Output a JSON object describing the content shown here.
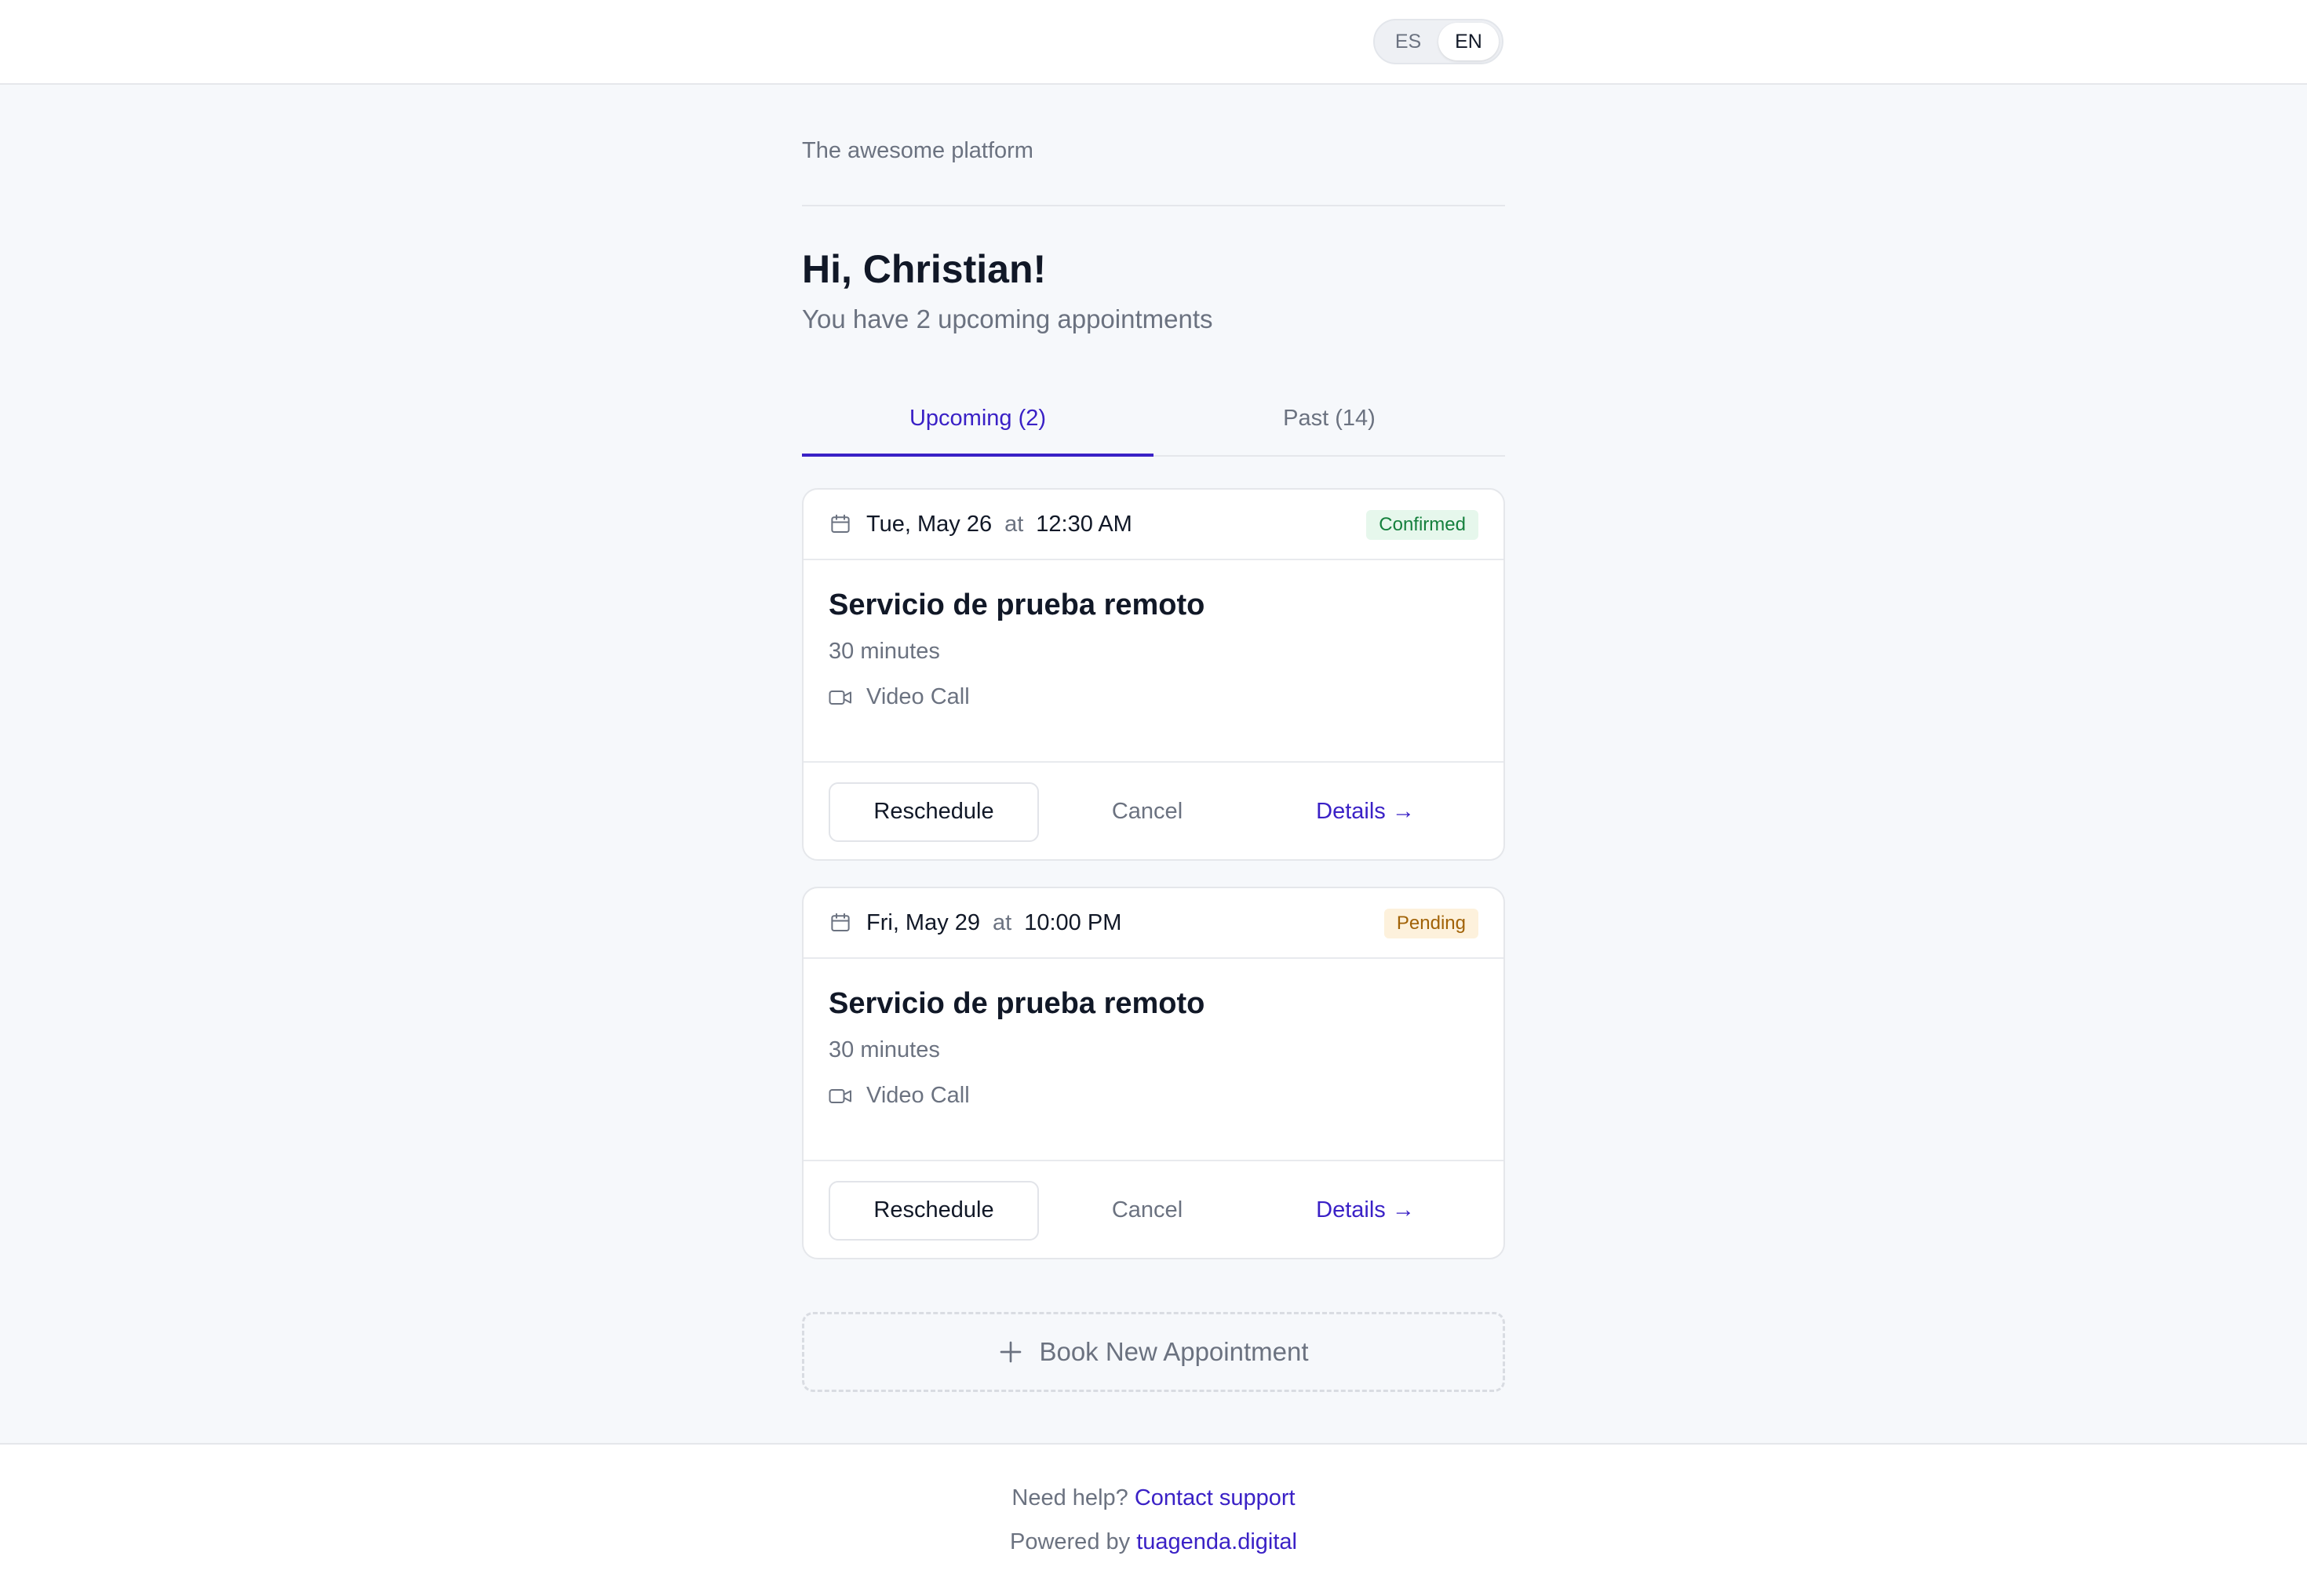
{
  "header": {
    "languages": [
      {
        "code": "ES",
        "active": false
      },
      {
        "code": "EN",
        "active": true
      }
    ]
  },
  "brand": "The awesome platform",
  "greeting": "Hi, Christian!",
  "subtitle": "You have 2 upcoming appointments",
  "tabs": [
    {
      "label": "Upcoming (2)",
      "active": true
    },
    {
      "label": "Past (14)",
      "active": false
    }
  ],
  "appointments": [
    {
      "date": "Tue, May 26",
      "at": "at",
      "time": "12:30 AM",
      "status": "Confirmed",
      "service": "Servicio de prueba remoto",
      "duration": "30 minutes",
      "location": "Video Call",
      "actions": {
        "reschedule": "Reschedule",
        "cancel": "Cancel",
        "details": "Details →"
      }
    },
    {
      "date": "Fri, May 29",
      "at": "at",
      "time": "10:00 PM",
      "status": "Pending",
      "service": "Servicio de prueba remoto",
      "duration": "30 minutes",
      "location": "Video Call",
      "actions": {
        "reschedule": "Reschedule",
        "cancel": "Cancel",
        "details": "Details →"
      }
    }
  ],
  "book_button": "Book New Appointment",
  "footer": {
    "help_text": "Need help?",
    "help_link": "Contact support",
    "powered_text": "Powered by",
    "powered_link": "tuagenda.digital"
  },
  "colors": {
    "accent": "#3a21c6",
    "confirmed_bg": "#e6f7ec",
    "confirmed_fg": "#15803d",
    "pending_bg": "#fdf1dc",
    "pending_fg": "#a16207",
    "page_bg": "#f6f8fb"
  },
  "icons": [
    "calendar-icon",
    "video-icon",
    "plus-icon"
  ]
}
